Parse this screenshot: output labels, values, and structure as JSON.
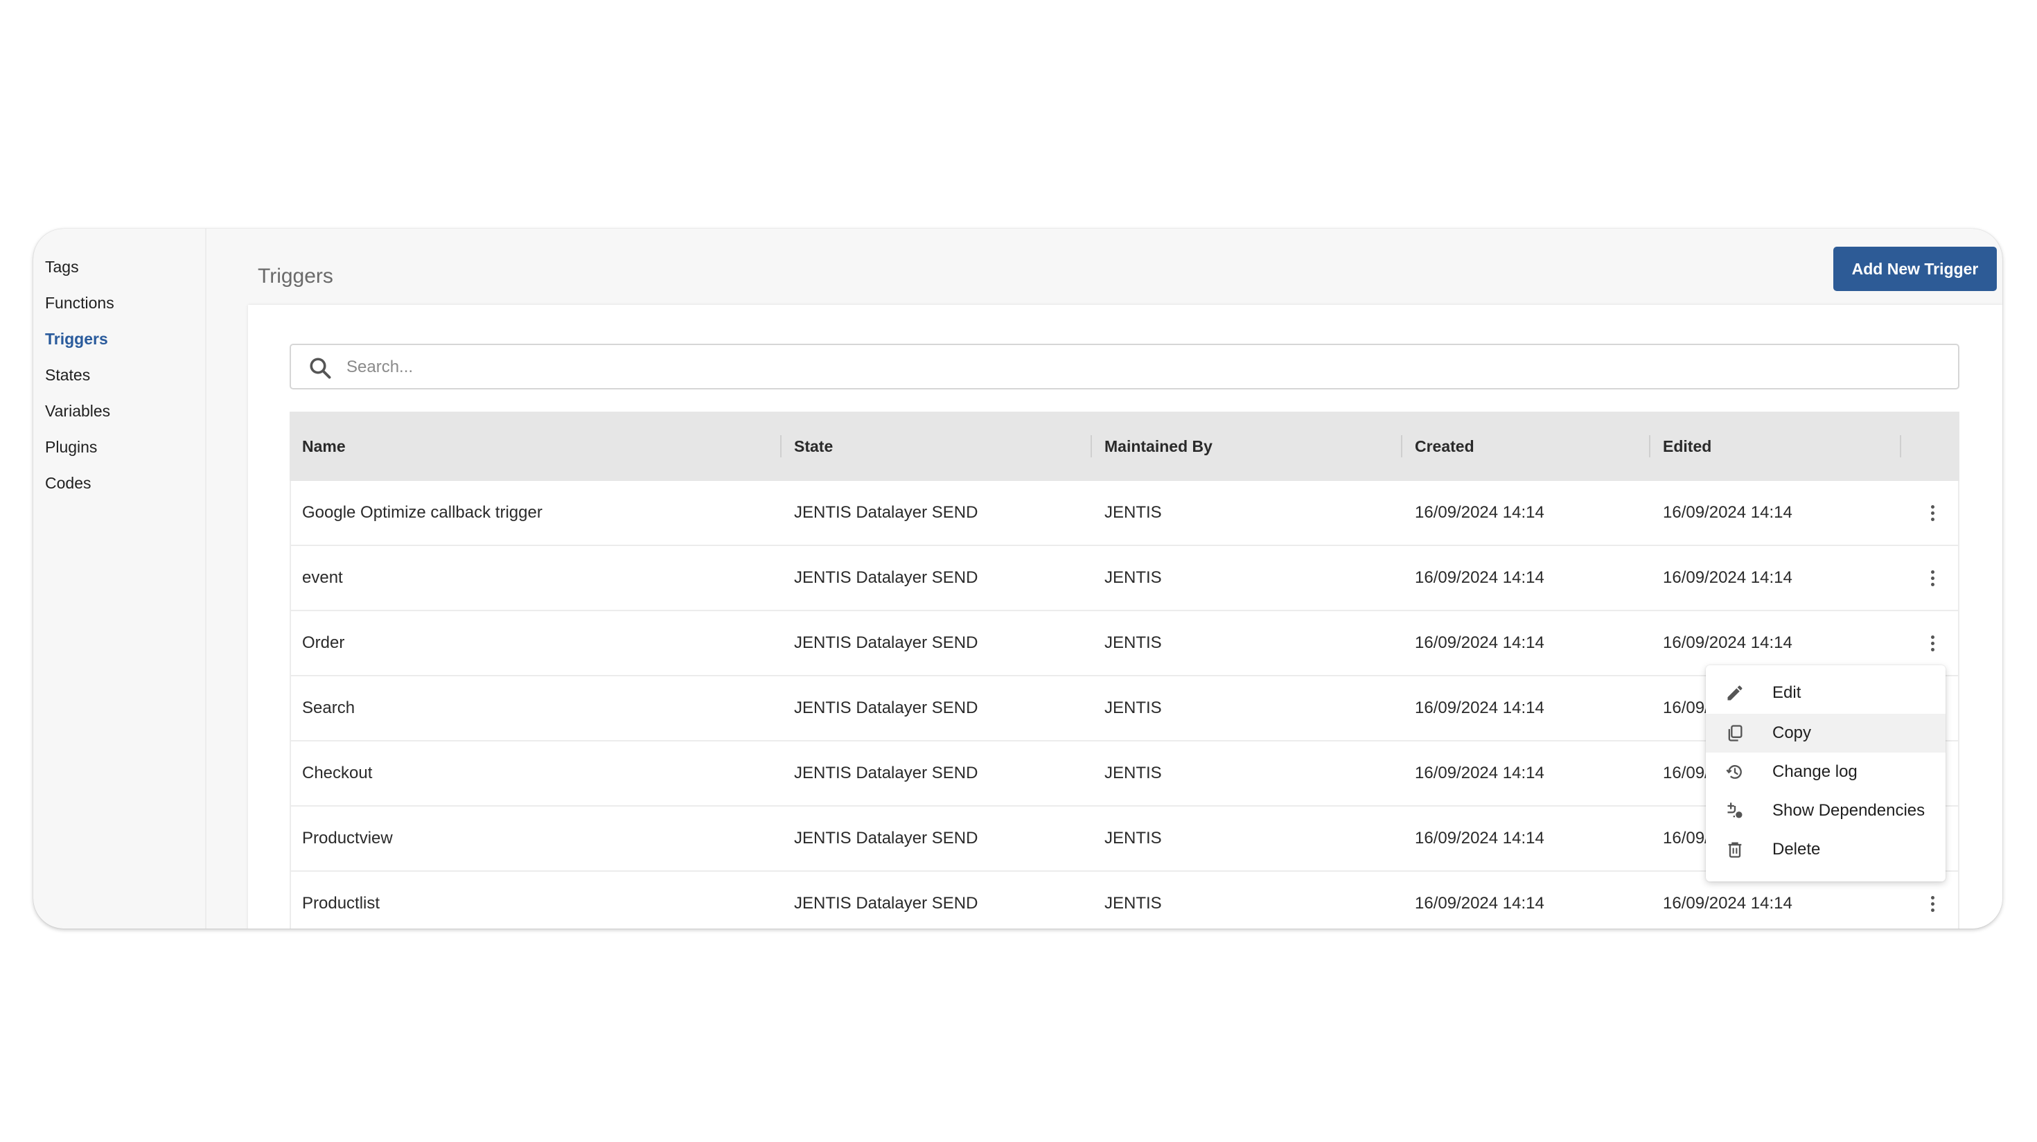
{
  "sidebar": {
    "items": [
      {
        "label": "Tags",
        "active": false
      },
      {
        "label": "Functions",
        "active": false
      },
      {
        "label": "Triggers",
        "active": true
      },
      {
        "label": "States",
        "active": false
      },
      {
        "label": "Variables",
        "active": false
      },
      {
        "label": "Plugins",
        "active": false
      },
      {
        "label": "Codes",
        "active": false
      }
    ]
  },
  "header": {
    "title": "Triggers",
    "add_button_label": "Add New Trigger"
  },
  "search": {
    "placeholder": "Search...",
    "value": ""
  },
  "table": {
    "columns": [
      "Name",
      "State",
      "Maintained By",
      "Created",
      "Edited"
    ],
    "rows": [
      {
        "name": "Google Optimize callback trigger",
        "state": "JENTIS Datalayer SEND",
        "maintained_by": "JENTIS",
        "created": "16/09/2024 14:14",
        "edited": "16/09/2024 14:14"
      },
      {
        "name": "event",
        "state": "JENTIS Datalayer SEND",
        "maintained_by": "JENTIS",
        "created": "16/09/2024 14:14",
        "edited": "16/09/2024 14:14"
      },
      {
        "name": "Order",
        "state": "JENTIS Datalayer SEND",
        "maintained_by": "JENTIS",
        "created": "16/09/2024 14:14",
        "edited": "16/09/2024 14:14"
      },
      {
        "name": "Search",
        "state": "JENTIS Datalayer SEND",
        "maintained_by": "JENTIS",
        "created": "16/09/2024 14:14",
        "edited": "16/09/2024 14:14"
      },
      {
        "name": "Checkout",
        "state": "JENTIS Datalayer SEND",
        "maintained_by": "JENTIS",
        "created": "16/09/2024 14:14",
        "edited": "16/09/2024 14:14"
      },
      {
        "name": "Productview",
        "state": "JENTIS Datalayer SEND",
        "maintained_by": "JENTIS",
        "created": "16/09/2024 14:14",
        "edited": "16/09/2024 14:14"
      },
      {
        "name": "Productlist",
        "state": "JENTIS Datalayer SEND",
        "maintained_by": "JENTIS",
        "created": "16/09/2024 14:14",
        "edited": "16/09/2024 14:14"
      }
    ]
  },
  "context_menu": {
    "items": [
      {
        "label": "Edit",
        "icon": "pencil-icon"
      },
      {
        "label": "Copy",
        "icon": "copy-icon"
      },
      {
        "label": "Change log",
        "icon": "history-icon"
      },
      {
        "label": "Show Dependencies",
        "icon": "dependencies-icon"
      },
      {
        "label": "Delete",
        "icon": "trash-icon"
      }
    ]
  },
  "colors": {
    "accent": "#2d5b96",
    "active_nav": "#2a5b9c",
    "header_bg": "#e6e6e6"
  }
}
